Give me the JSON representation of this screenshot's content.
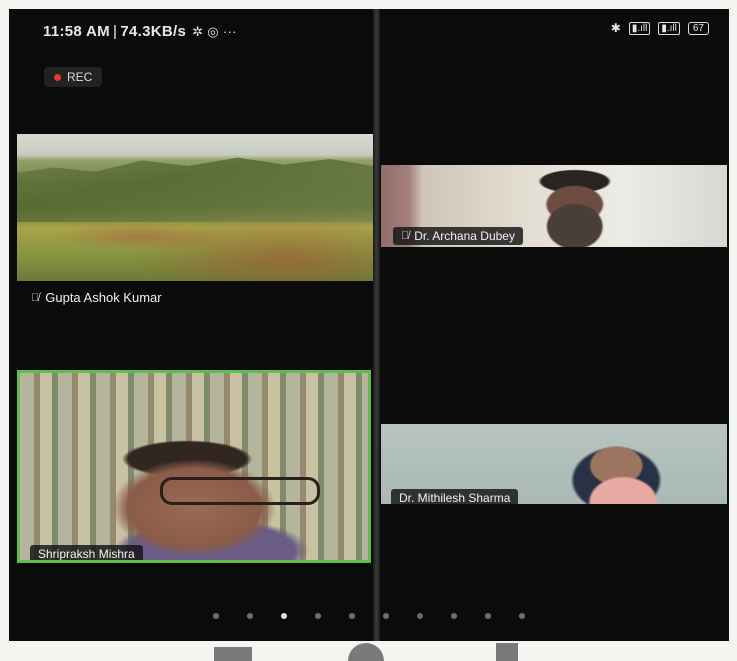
{
  "status_bar": {
    "time": "11:58 AM",
    "speed": "74.3KB/s",
    "left_icons": "✲ ◎ ···",
    "right_icons": [
      "bluetooth-icon",
      "sim-1-signal-icon",
      "sim-2-signal-icon"
    ],
    "battery": "67"
  },
  "recording": {
    "label": "REC",
    "color": "#e23a3a"
  },
  "participants": [
    {
      "name": "Gupta Ashok Kumar",
      "muted": true
    },
    {
      "name": "Dr. Archana Dubey",
      "muted": true
    },
    {
      "name": "Shripraksh Mishra",
      "muted": false,
      "active_speaker": true
    },
    {
      "name": "Dr. Mithilesh Sharma",
      "muted": false
    }
  ],
  "pagination": {
    "count": 10,
    "active_index": 2
  },
  "colors": {
    "background": "#0c0b0b",
    "active_speaker_border": "#5fbe4b"
  }
}
